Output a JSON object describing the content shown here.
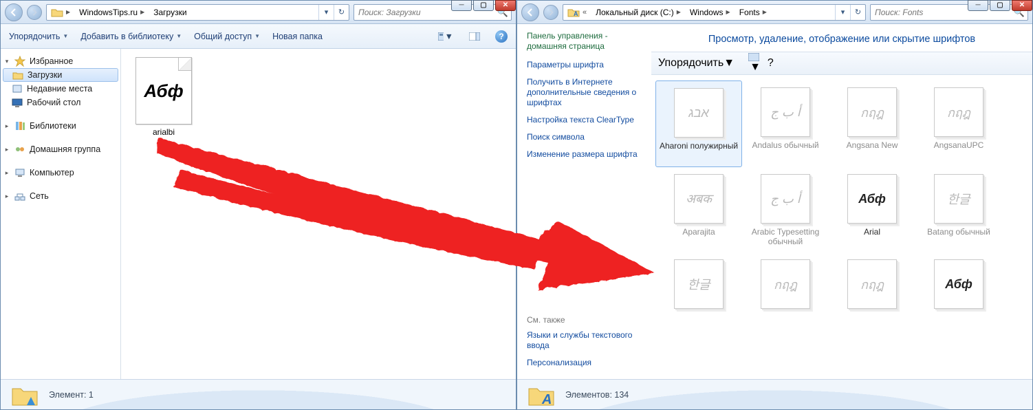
{
  "left": {
    "caption_tooltips": {
      "min": "Свернуть",
      "max": "Развернуть",
      "close": "Закрыть"
    },
    "breadcrumb": [
      {
        "label": "WindowsTips.ru"
      },
      {
        "label": "Загрузки"
      }
    ],
    "search_placeholder": "Поиск: Загрузки",
    "toolbar": {
      "organize": "Упорядочить",
      "add_library": "Добавить в библиотеку",
      "share": "Общий доступ",
      "new_folder": "Новая папка"
    },
    "nav": {
      "favorites": "Избранное",
      "downloads": "Загрузки",
      "recent": "Недавние места",
      "desktop": "Рабочий стол",
      "libraries": "Библиотеки",
      "homegroup": "Домашняя группа",
      "computer": "Компьютер",
      "network": "Сеть"
    },
    "file": {
      "name": "arialbi",
      "glyph": "Абф"
    },
    "status": "Элемент: 1"
  },
  "right": {
    "breadcrumb": [
      {
        "label": "Локальный диск (C:)"
      },
      {
        "label": "Windows"
      },
      {
        "label": "Fonts"
      }
    ],
    "breadcrumb_prefix": "«",
    "search_placeholder": "Поиск: Fonts",
    "cpane": {
      "home": "Панель управления - домашняя страница",
      "params": "Параметры шрифта",
      "online": "Получить в Интернете дополнительные сведения о шрифтах",
      "cleartype": "Настройка текста ClearType",
      "charmap": "Поиск символа",
      "resize": "Изменение размера шрифта",
      "see_also": "См. также",
      "lang": "Языки и службы текстового ввода",
      "personalize": "Персонализация"
    },
    "heading": "Просмотр, удаление, отображение или скрытие шрифтов",
    "toolbar": {
      "organize": "Упорядочить"
    },
    "fonts": [
      {
        "name": "Aharoni полужирный",
        "glyph": "אבג",
        "selected": true
      },
      {
        "name": "Andalus обычный",
        "glyph": "أ ب ج",
        "dim": true
      },
      {
        "name": "Angsana New",
        "glyph": "กฤฎ",
        "dim": true
      },
      {
        "name": "AngsanaUPC",
        "glyph": "กฤฎ",
        "dim": true
      },
      {
        "name": "Aparajita",
        "glyph": "अबक",
        "dim": true
      },
      {
        "name": "Arabic Typesetting обычный",
        "glyph": "أ ب ج",
        "dim": true
      },
      {
        "name": "Arial",
        "glyph": "Абф",
        "bold": true
      },
      {
        "name": "Batang обычный",
        "glyph": "한글",
        "dim": true
      },
      {
        "name": "",
        "glyph": "한글",
        "dim": true
      },
      {
        "name": "",
        "glyph": "กฤฎ",
        "dim": true
      },
      {
        "name": "",
        "glyph": "กฤฎ",
        "dim": true
      },
      {
        "name": "",
        "glyph": "Абф",
        "bold": true
      }
    ],
    "status": "Элементов: 134"
  }
}
